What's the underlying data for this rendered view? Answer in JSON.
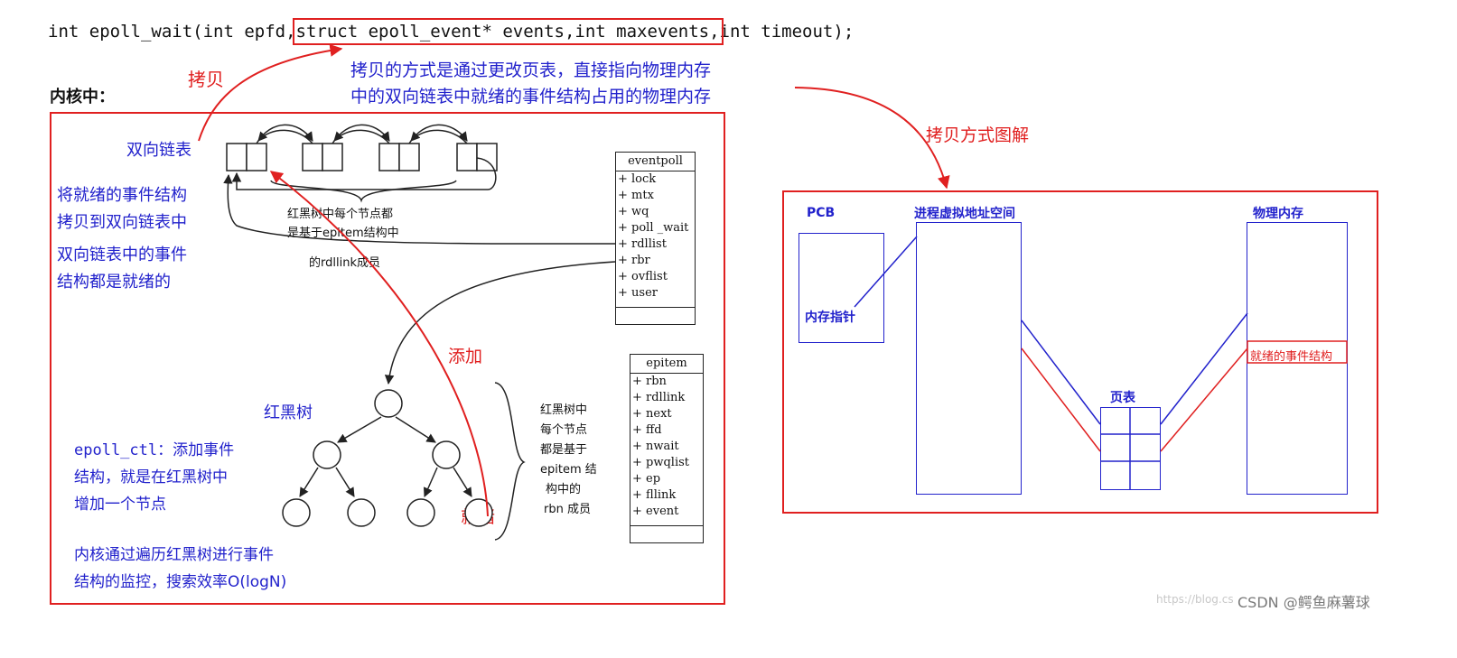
{
  "signature": {
    "pre": "int epoll_wait(int epfd,",
    "highlight": "struct epoll_event* events,int maxevents,",
    "post": "int timeout);"
  },
  "labels": {
    "copy": "拷贝",
    "copy_desc_1": "拷贝的方式是通过更改页表，直接指向物理内存",
    "copy_desc_2": "中的双向链表中就绪的事件结构占用的物理内存",
    "in_kernel": "内核中：",
    "copy_diagram": "拷贝方式图解",
    "dlist": "双向链表",
    "ready_to_list_1": "将就绪的事件结构",
    "ready_to_list_2": "拷贝到双向链表中",
    "list_ready_1": "双向链表中的事件",
    "list_ready_2": "结构都是就绪的",
    "rbtree_note_1": "红黑树中每个节点都",
    "rbtree_note_2": "是基于epitem结构中",
    "rbtree_note_3": "的rdllink成员",
    "add": "添加",
    "rbtree": "红黑树",
    "ctl_1": "epoll_ctl：添加事件",
    "ctl_2": "结构，就是在红黑树中",
    "ctl_3": "增加一个节点",
    "ready": "就绪",
    "traverse_1": "内核通过遍历红黑树进行事件",
    "traverse_2": "结构的监控，搜索效率O(logN)",
    "rbn_note": [
      "红黑树中",
      "每个节点",
      "都是基于",
      "epitem 结",
      "构中的",
      "rbn 成员"
    ],
    "pcb": "PCB",
    "vaddr": "进程虚拟地址空间",
    "phys": "物理内存",
    "mem_ptr": "内存指针",
    "page_table": "页表",
    "ready_struct": "就绪的事件结构",
    "watermark_url": "https://blog.cs",
    "watermark": "CSDN @鳄鱼麻薯球"
  },
  "eventpoll": {
    "title": "eventpoll",
    "fields": [
      "+ lock",
      "+ mtx",
      "+ wq",
      "+ poll _wait",
      "+ rdllist",
      "+ rbr",
      "+ ovflist",
      "+ user"
    ]
  },
  "epitem": {
    "title": "epitem",
    "fields": [
      "+ rbn",
      "+ rdllink",
      "+ next",
      "+ ffd",
      "+ nwait",
      "+ pwqlist",
      "+ ep",
      "+ fllink",
      "+ event"
    ]
  },
  "colors": {
    "red": "#e02020",
    "blue": "#2222cc",
    "black": "#222222"
  }
}
